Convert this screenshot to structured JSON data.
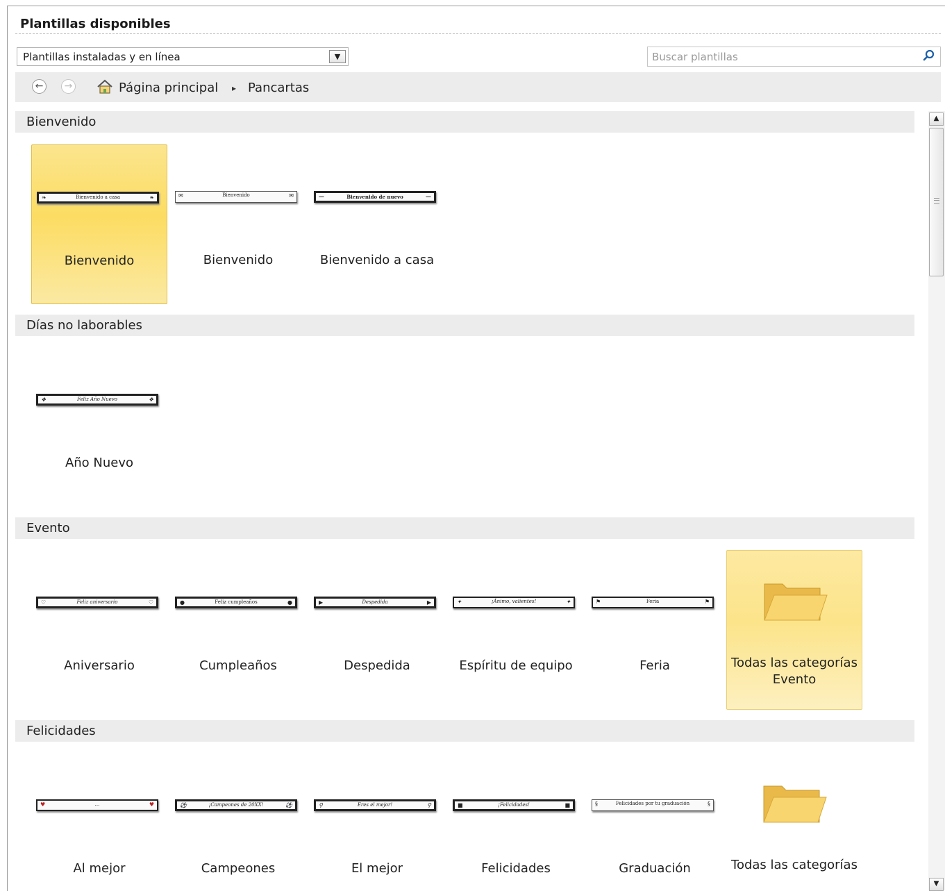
{
  "header": {
    "title": "Plantillas disponibles",
    "source_select": "Plantillas instaladas y en línea",
    "search_placeholder": "Buscar plantillas"
  },
  "nav": {
    "breadcrumb_home": "Página principal",
    "breadcrumb_separator": "▸",
    "breadcrumb_current": "Pancartas"
  },
  "sections": [
    {
      "title": "Bienvenido",
      "items": [
        {
          "label": "Bienvenido",
          "banner_text": "Bienvenido a casa",
          "state": "selected",
          "icon": "leaf"
        },
        {
          "label": "Bienvenido",
          "banner_text": "Bienvenido",
          "state": "normal",
          "icon": "envelope"
        },
        {
          "label": "Bienvenido a casa",
          "banner_text": "Bienvenido de nuevo",
          "state": "normal",
          "icon": "dash"
        }
      ]
    },
    {
      "title": "Días no laborables",
      "items": [
        {
          "label": "Año Nuevo",
          "banner_text": "Feliz Año Nuevo",
          "state": "normal",
          "icon": "ornament"
        }
      ]
    },
    {
      "title": "Evento",
      "items": [
        {
          "label": "Aniversario",
          "banner_text": "Feliz aniversario",
          "state": "normal",
          "icon": "heart"
        },
        {
          "label": "Cumpleaños",
          "banner_text": "Feliz cumpleaños",
          "state": "normal",
          "icon": "balloon"
        },
        {
          "label": "Despedida",
          "banner_text": "Despedida",
          "state": "normal",
          "icon": "arrow"
        },
        {
          "label": "Espíritu de equipo",
          "banner_text": "¡Ánimo, valientes!",
          "state": "normal",
          "icon": "star"
        },
        {
          "label": "Feria",
          "banner_text": "Feria",
          "state": "normal",
          "icon": "flag"
        },
        {
          "label": "Todas las categorías Evento",
          "type": "folder",
          "state": "hover"
        }
      ]
    },
    {
      "title": "Felicidades",
      "items": [
        {
          "label": "Al mejor",
          "banner_text": "...",
          "state": "normal",
          "icon": "heart"
        },
        {
          "label": "Campeones",
          "banner_text": "¡Campeones de 20XX!",
          "state": "normal",
          "icon": "ball"
        },
        {
          "label": "El mejor",
          "banner_text": "Eres el mejor!",
          "state": "normal",
          "icon": "ribbon"
        },
        {
          "label": "Felicidades",
          "banner_text": "¡Felicidades!",
          "state": "normal",
          "icon": "square"
        },
        {
          "label": "Graduación",
          "banner_text": "Felicidades por tu graduación",
          "state": "normal",
          "icon": "cap"
        },
        {
          "label": "Todas las categorías",
          "type": "folder",
          "state": "normal"
        }
      ]
    }
  ],
  "colors": {
    "selected_fill": "#fcdc62",
    "section_bar": "#ececec",
    "folder": "#f7cf61",
    "search_icon": "#1b5fa8"
  }
}
